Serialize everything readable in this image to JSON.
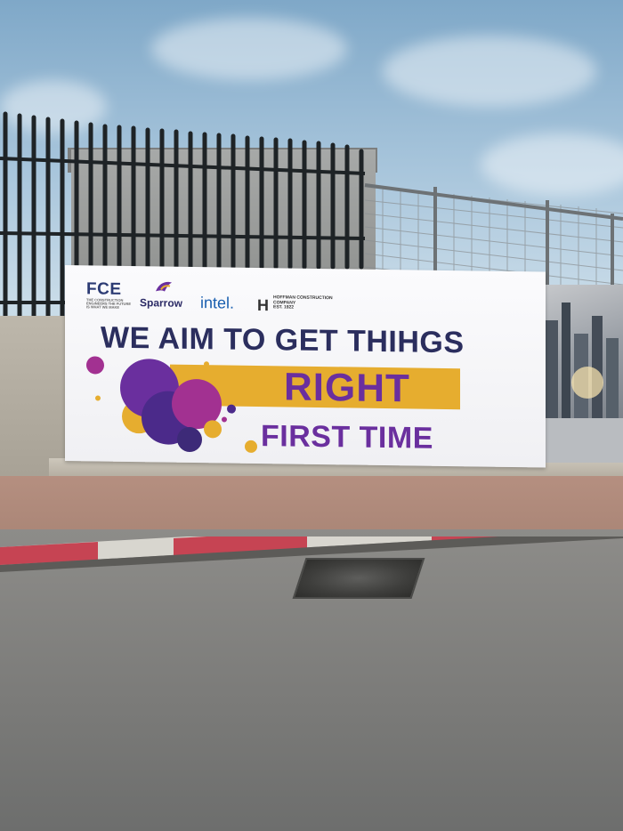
{
  "banner": {
    "logos": {
      "fce": "FCE",
      "fce_tagline": "THE CONSTRUCTION ENGINEERS THE FUTURE IS WHAT WE MAKE",
      "sparrow": "Sparrow",
      "intel": "intel.",
      "hoffman": "HOFFMAN CONSTRUCTION COMPANY",
      "hoffman_sub": "EST. 1922"
    },
    "headline": "WE AIM TO GET THIHGS",
    "highlight": "RIGHT",
    "subline": "FIRST TIME"
  },
  "colors": {
    "banner_navy": "#2b2e5e",
    "banner_purple": "#6a2f9e",
    "banner_yellow": "#e6ad2f",
    "banner_magenta": "#a23191",
    "intel_blue": "#1a5fb0"
  }
}
